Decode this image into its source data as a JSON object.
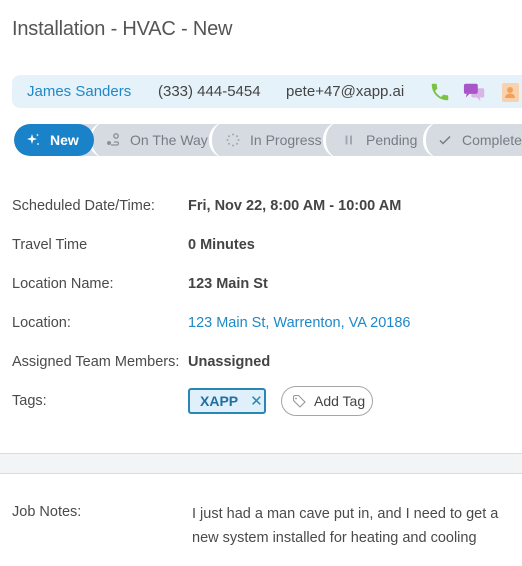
{
  "page": {
    "title": "Installation - HVAC - New"
  },
  "contact": {
    "name": "James Sanders",
    "phone": "(333) 444-5454",
    "email": "pete+47@xapp.ai",
    "icons": [
      "phone-icon",
      "chat-icon",
      "contact-card-icon"
    ],
    "colors": {
      "name": "#1e88c8",
      "phone_icon": "#7bc242",
      "chat_icon": "#a855c8",
      "contact_icon": "#f2a15c"
    }
  },
  "status": {
    "active": "New",
    "steps": [
      {
        "label": "New",
        "icon": "sparkle-icon",
        "active": true
      },
      {
        "label": "On The Way",
        "icon": "route-icon",
        "active": false
      },
      {
        "label": "In Progress",
        "icon": "spinner-icon",
        "active": false
      },
      {
        "label": "Pending",
        "icon": "pause-icon",
        "active": false
      },
      {
        "label": "Completed",
        "icon": "check-icon",
        "active": false
      }
    ],
    "colors": {
      "active": "#1a82c8",
      "inactive": "#d6dbe1"
    }
  },
  "details": {
    "scheduled": {
      "label": "Scheduled Date/Time:",
      "value": "Fri, Nov 22, 8:00 AM - 10:00 AM"
    },
    "travel": {
      "label": "Travel Time",
      "value": "0 Minutes"
    },
    "location_name": {
      "label": "Location Name:",
      "value": "123 Main St"
    },
    "location": {
      "label": "Location:",
      "value": "123 Main St, Warrenton, VA 20186"
    },
    "assigned": {
      "label": "Assigned Team Members:",
      "value": "Unassigned"
    },
    "tags": {
      "label": "Tags:",
      "items": [
        {
          "label": "XAPP"
        }
      ],
      "add_label": "Add Tag"
    }
  },
  "notes": {
    "label": "Job Notes:",
    "text": "I just had a man cave put in, and I need to get a new system installed for heating and cooling"
  }
}
